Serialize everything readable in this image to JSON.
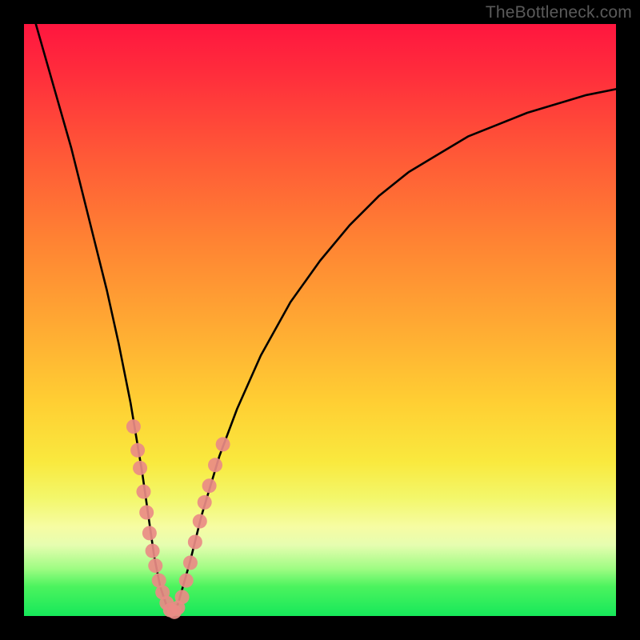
{
  "watermark": "TheBottleneck.com",
  "chart_data": {
    "type": "line",
    "title": "",
    "xlabel": "",
    "ylabel": "",
    "xlim": [
      0,
      100
    ],
    "ylim": [
      0,
      100
    ],
    "grid": false,
    "series": [
      {
        "name": "bottleneck-curve",
        "color": "#000000",
        "x": [
          2,
          4,
          6,
          8,
          10,
          12,
          14,
          16,
          18,
          20,
          21,
          22,
          23,
          24,
          25,
          26,
          28,
          30,
          33,
          36,
          40,
          45,
          50,
          55,
          60,
          65,
          70,
          75,
          80,
          85,
          90,
          95,
          100
        ],
        "y": [
          100,
          93,
          86,
          79,
          71,
          63,
          55,
          46,
          36,
          24,
          17,
          10,
          5,
          2,
          0.5,
          2,
          9,
          17,
          27,
          35,
          44,
          53,
          60,
          66,
          71,
          75,
          78,
          81,
          83,
          85,
          86.5,
          88,
          89
        ]
      }
    ],
    "markers": [
      {
        "name": "dot-cluster",
        "color": "#e98b85",
        "points": [
          {
            "x": 18.5,
            "y": 32
          },
          {
            "x": 19.2,
            "y": 28
          },
          {
            "x": 19.6,
            "y": 25
          },
          {
            "x": 20.2,
            "y": 21
          },
          {
            "x": 20.7,
            "y": 17.5
          },
          {
            "x": 21.2,
            "y": 14
          },
          {
            "x": 21.7,
            "y": 11
          },
          {
            "x": 22.2,
            "y": 8.5
          },
          {
            "x": 22.8,
            "y": 6
          },
          {
            "x": 23.4,
            "y": 4
          },
          {
            "x": 24.1,
            "y": 2.2
          },
          {
            "x": 24.7,
            "y": 1.0
          },
          {
            "x": 25.4,
            "y": 0.7
          },
          {
            "x": 26.0,
            "y": 1.4
          },
          {
            "x": 26.7,
            "y": 3.2
          },
          {
            "x": 27.4,
            "y": 6.0
          },
          {
            "x": 28.1,
            "y": 9.0
          },
          {
            "x": 28.9,
            "y": 12.5
          },
          {
            "x": 29.7,
            "y": 16.0
          },
          {
            "x": 30.5,
            "y": 19.2
          },
          {
            "x": 31.3,
            "y": 22.0
          },
          {
            "x": 32.3,
            "y": 25.5
          },
          {
            "x": 33.6,
            "y": 29.0
          }
        ]
      }
    ]
  }
}
